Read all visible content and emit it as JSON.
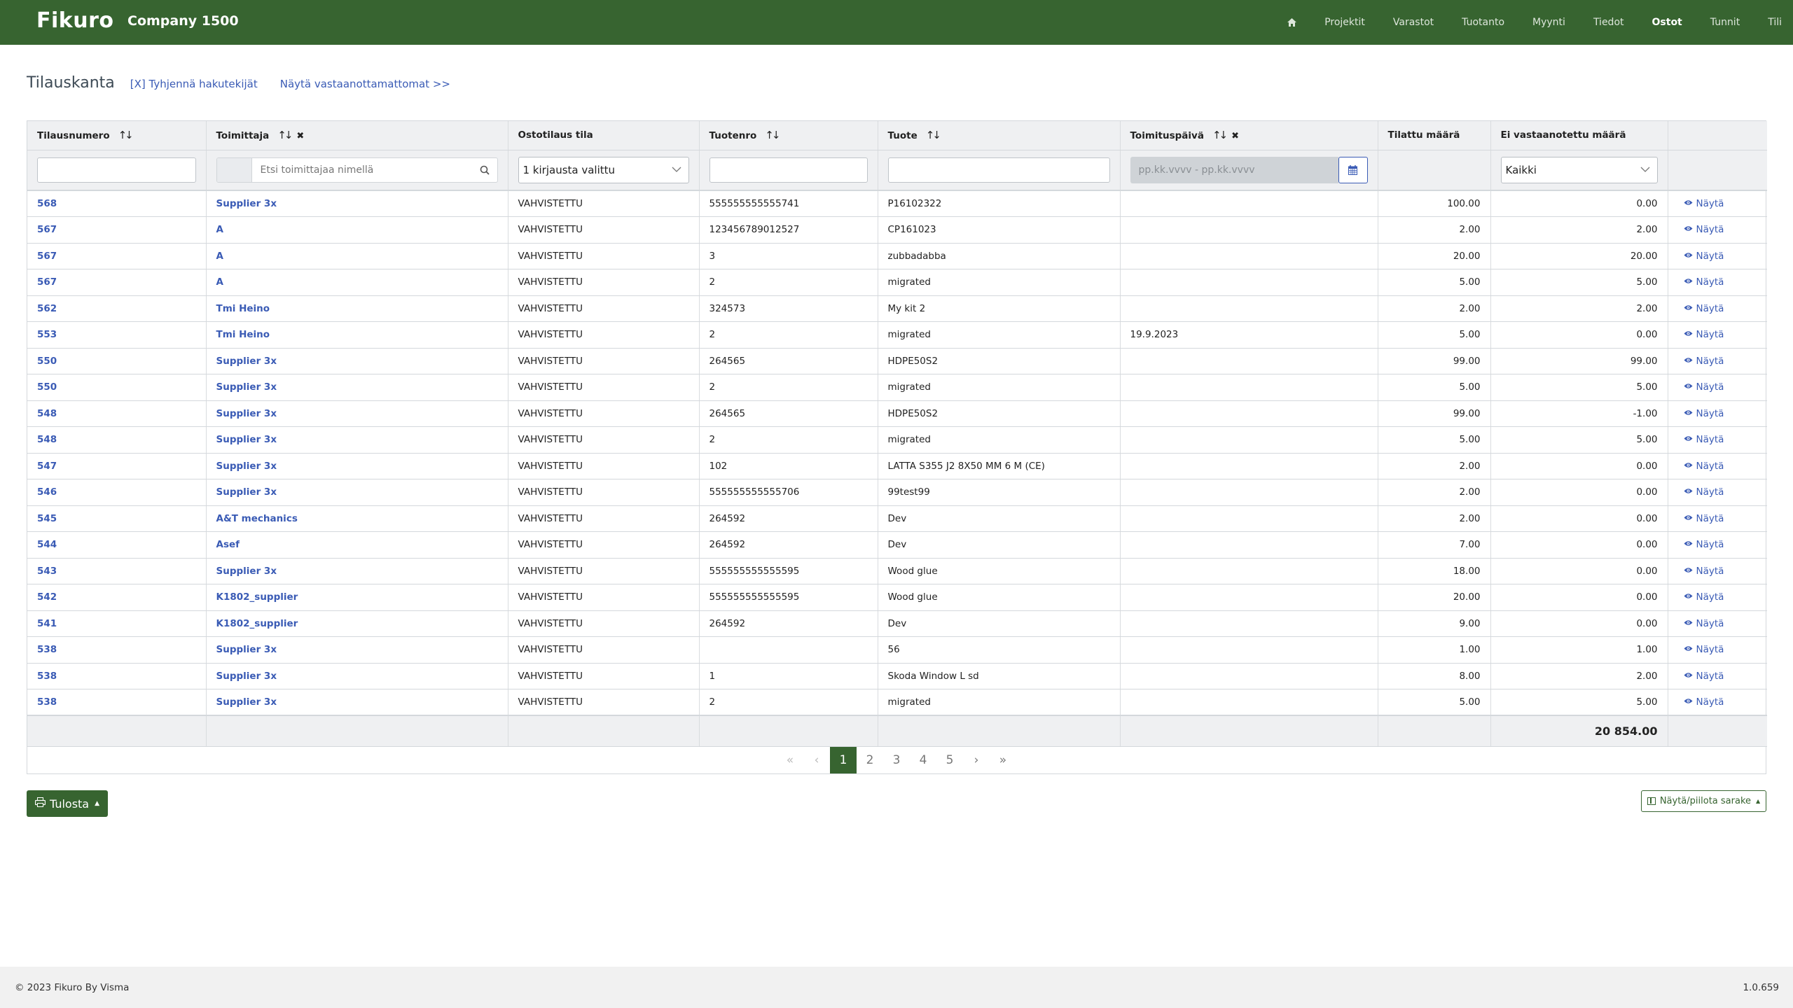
{
  "navbar": {
    "brand": "Fikuro",
    "company": "Company 1500",
    "home_icon": "home-icon",
    "items": [
      {
        "label": "Projektit",
        "active": false
      },
      {
        "label": "Varastot",
        "active": false
      },
      {
        "label": "Tuotanto",
        "active": false
      },
      {
        "label": "Myynti",
        "active": false
      },
      {
        "label": "Tiedot",
        "active": false
      },
      {
        "label": "Ostot",
        "active": true
      },
      {
        "label": "Tunnit",
        "active": false
      },
      {
        "label": "Tili",
        "active": false
      }
    ]
  },
  "page": {
    "title": "Tilauskanta",
    "clear_filters_link": "[X] Tyhjennä hakutekijät",
    "show_unreceived_link": "Näytä vastaanottamattomat  >>"
  },
  "table": {
    "columns": {
      "order_number": "Tilausnumero",
      "supplier": "Toimittaja",
      "status": "Ostotilaus tila",
      "product_number": "Tuotenro",
      "product": "Tuote",
      "delivery_date": "Toimituspäivä",
      "ordered_qty": "Tilattu määrä",
      "unreceived_qty": "Ei vastaanotettu määrä"
    },
    "filters": {
      "order_number_value": "",
      "supplier_placeholder": "Etsi toimittajaa nimellä",
      "status_selected": "1 kirjausta valittu",
      "product_number_value": "",
      "product_value": "",
      "delivery_date_placeholder": "pp.kk.vvvv - pp.kk.vvvv",
      "unreceived_selected": "Kaikki"
    },
    "view_label": "Näytä",
    "rows": [
      {
        "order": "568",
        "supplier": "Supplier 3x",
        "status": "VAHVISTETTU",
        "product_no": "555555555555741",
        "product": "P16102322",
        "date": "",
        "ordered": "100.00",
        "unreceived": "0.00"
      },
      {
        "order": "567",
        "supplier": "A",
        "status": "VAHVISTETTU",
        "product_no": "123456789012527",
        "product": "CP161023",
        "date": "",
        "ordered": "2.00",
        "unreceived": "2.00"
      },
      {
        "order": "567",
        "supplier": "A",
        "status": "VAHVISTETTU",
        "product_no": "3",
        "product": "zubbadabba",
        "date": "",
        "ordered": "20.00",
        "unreceived": "20.00"
      },
      {
        "order": "567",
        "supplier": "A",
        "status": "VAHVISTETTU",
        "product_no": "2",
        "product": "migrated",
        "date": "",
        "ordered": "5.00",
        "unreceived": "5.00"
      },
      {
        "order": "562",
        "supplier": "Tmi Heino",
        "status": "VAHVISTETTU",
        "product_no": "324573",
        "product": "My kit 2",
        "date": "",
        "ordered": "2.00",
        "unreceived": "2.00"
      },
      {
        "order": "553",
        "supplier": "Tmi Heino",
        "status": "VAHVISTETTU",
        "product_no": "2",
        "product": "migrated",
        "date": "19.9.2023",
        "ordered": "5.00",
        "unreceived": "0.00"
      },
      {
        "order": "550",
        "supplier": "Supplier 3x",
        "status": "VAHVISTETTU",
        "product_no": "264565",
        "product": "HDPE50S2",
        "date": "",
        "ordered": "99.00",
        "unreceived": "99.00"
      },
      {
        "order": "550",
        "supplier": "Supplier 3x",
        "status": "VAHVISTETTU",
        "product_no": "2",
        "product": "migrated",
        "date": "",
        "ordered": "5.00",
        "unreceived": "5.00"
      },
      {
        "order": "548",
        "supplier": "Supplier 3x",
        "status": "VAHVISTETTU",
        "product_no": "264565",
        "product": "HDPE50S2",
        "date": "",
        "ordered": "99.00",
        "unreceived": "-1.00"
      },
      {
        "order": "548",
        "supplier": "Supplier 3x",
        "status": "VAHVISTETTU",
        "product_no": "2",
        "product": "migrated",
        "date": "",
        "ordered": "5.00",
        "unreceived": "5.00"
      },
      {
        "order": "547",
        "supplier": "Supplier 3x",
        "status": "VAHVISTETTU",
        "product_no": "102",
        "product": "LATTA S355 J2 8X50 MM 6 M (CE)",
        "date": "",
        "ordered": "2.00",
        "unreceived": "0.00"
      },
      {
        "order": "546",
        "supplier": "Supplier 3x",
        "status": "VAHVISTETTU",
        "product_no": "555555555555706",
        "product": "99test99",
        "date": "",
        "ordered": "2.00",
        "unreceived": "0.00"
      },
      {
        "order": "545",
        "supplier": "A&T mechanics",
        "status": "VAHVISTETTU",
        "product_no": "264592",
        "product": "Dev",
        "date": "",
        "ordered": "2.00",
        "unreceived": "0.00"
      },
      {
        "order": "544",
        "supplier": "Asef",
        "status": "VAHVISTETTU",
        "product_no": "264592",
        "product": "Dev",
        "date": "",
        "ordered": "7.00",
        "unreceived": "0.00"
      },
      {
        "order": "543",
        "supplier": "Supplier 3x",
        "status": "VAHVISTETTU",
        "product_no": "555555555555595",
        "product": "Wood glue",
        "date": "",
        "ordered": "18.00",
        "unreceived": "0.00"
      },
      {
        "order": "542",
        "supplier": "K1802_supplier",
        "status": "VAHVISTETTU",
        "product_no": "555555555555595",
        "product": "Wood glue",
        "date": "",
        "ordered": "20.00",
        "unreceived": "0.00"
      },
      {
        "order": "541",
        "supplier": "K1802_supplier",
        "status": "VAHVISTETTU",
        "product_no": "264592",
        "product": "Dev",
        "date": "",
        "ordered": "9.00",
        "unreceived": "0.00"
      },
      {
        "order": "538",
        "supplier": "Supplier 3x",
        "status": "VAHVISTETTU",
        "product_no": "",
        "product": "56",
        "date": "",
        "ordered": "1.00",
        "unreceived": "1.00"
      },
      {
        "order": "538",
        "supplier": "Supplier 3x",
        "status": "VAHVISTETTU",
        "product_no": "1",
        "product": "Skoda Window L sd",
        "date": "",
        "ordered": "8.00",
        "unreceived": "2.00"
      },
      {
        "order": "538",
        "supplier": "Supplier 3x",
        "status": "VAHVISTETTU",
        "product_no": "2",
        "product": "migrated",
        "date": "",
        "ordered": "5.00",
        "unreceived": "5.00"
      }
    ],
    "total_unreceived": "20 854.00"
  },
  "pagination": {
    "first": "«",
    "prev": "‹",
    "pages": [
      "1",
      "2",
      "3",
      "4",
      "5"
    ],
    "current": "1",
    "next": "›",
    "last": "»"
  },
  "actions": {
    "print_label": "Tulosta",
    "columns_label": "Näytä/piilota sarake"
  },
  "footer": {
    "copyright": "© 2023 Fikuro By Visma",
    "version": "1.0.659"
  },
  "colors": {
    "brand_green": "#376430",
    "link_blue": "#3a5bb5",
    "header_bg": "#eff0f2",
    "footer_bg": "#f1f1f1"
  }
}
